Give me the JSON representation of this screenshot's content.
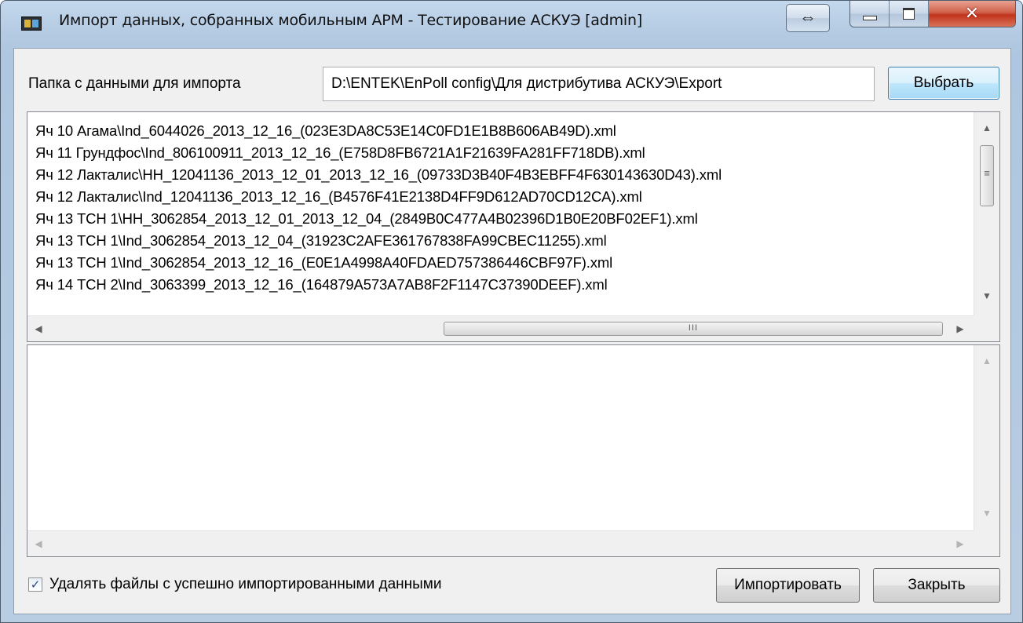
{
  "window": {
    "title": "Импорт данных, собранных мобильным АРМ - Тестирование АСКУЭ [admin]",
    "resize_glyph": "⇔",
    "close_glyph": "✕"
  },
  "folder": {
    "label": "Папка с данными для импорта",
    "value": "D:\\ENTEK\\EnPoll config\\Для дистрибутива АСКУЭ\\Export",
    "browse_label": "Выбрать"
  },
  "files": [
    "Яч 10 Агама\\Ind_6044026_2013_12_16_(023E3DA8C53E14C0FD1E1B8B606AB49D).xml",
    "Яч 11 Грундфос\\Ind_806100911_2013_12_16_(E758D8FB6721A1F21639FA281FF718DB).xml",
    "Яч 12 Лакталис\\HH_12041136_2013_12_01_2013_12_16_(09733D3B40F4B3EBFF4F630143630D43).xml",
    "Яч 12 Лакталис\\Ind_12041136_2013_12_16_(B4576F41E2138D4FF9D612AD70CD12CA).xml",
    "Яч 13 ТСН 1\\HH_3062854_2013_12_01_2013_12_04_(2849B0C477A4B02396D1B0E20BF02EF1).xml",
    "Яч 13 ТСН 1\\Ind_3062854_2013_12_04_(31923C2AFE361767838FA99CBEC11255).xml",
    "Яч 13 ТСН 1\\Ind_3062854_2013_12_16_(E0E1A4998A40FDAED757386446CBF97F).xml",
    "Яч 14 ТСН 2\\Ind_3063399_2013_12_16_(164879A573A7AB8F2F1147C37390DEEF).xml"
  ],
  "scroll": {
    "up": "▲",
    "down": "▼",
    "left": "◀",
    "right": "▶",
    "grip_h": "III",
    "grip_v": "≡"
  },
  "options": {
    "delete_label": "Удалять файлы с успешно импортированными данными",
    "delete_checked": true,
    "check_mark": "✓"
  },
  "actions": {
    "import_label": "Импортировать",
    "close_label": "Закрыть"
  }
}
